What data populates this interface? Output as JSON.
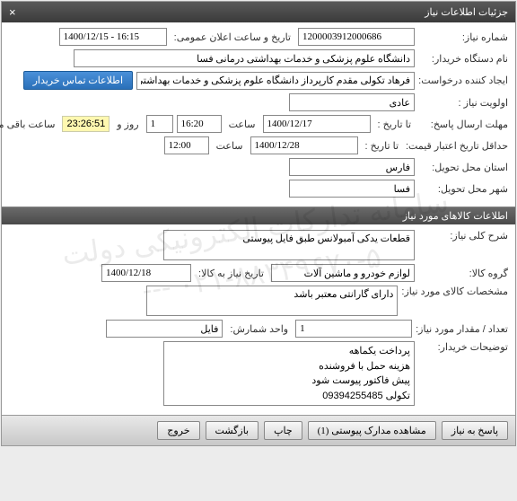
{
  "window": {
    "title": "جزئیات اطلاعات نیاز",
    "close": "×"
  },
  "form": {
    "need_number_label": "شماره نیاز:",
    "need_number": "1200003912000686",
    "public_datetime_label": "تاریخ و ساعت اعلان عمومی:",
    "public_datetime": "1400/12/15 - 16:15",
    "buyer_org_label": "نام دستگاه خریدار:",
    "buyer_org": "دانشگاه علوم پزشکی و خدمات بهداشتی درمانی فسا",
    "creator_label": "ایجاد کننده درخواست:",
    "creator": "فرهاد تکولی مقدم کارپرداز دانشگاه علوم پزشکی و خدمات بهداشتی درمانی فسا",
    "contact_btn": "اطلاعات تماس خریدار",
    "priority_label": "اولویت نیاز :",
    "priority": "عادی",
    "deadline_label": "مهلت ارسال پاسخ:",
    "to_date_label": "تا تاریخ :",
    "deadline_date": "1400/12/17",
    "time_label": "ساعت",
    "deadline_time": "16:20",
    "days": "1",
    "days_label": "روز و",
    "remaining_time": "23:26:51",
    "remaining_label": "ساعت باقی مانده",
    "price_validity_label": "حداقل تاریخ اعتبار قیمت:",
    "price_validity_date": "1400/12/28",
    "price_validity_time": "12:00",
    "province_label": "استان محل تحویل:",
    "province": "فارس",
    "city_label": "شهر محل تحویل:",
    "city": "فسا"
  },
  "section2_title": "اطلاعات کالاهای مورد نیاز",
  "goods": {
    "desc_label": "شرح کلی نیاز:",
    "desc": "قطعات یدکی آمبولانس طبق فایل پیوستی",
    "group_label": "گروه کالا:",
    "group": "لوازم خودرو و ماشین آلات",
    "need_date_label": "تاریخ نیاز به کالا:",
    "need_date": "1400/12/18",
    "spec_label": "مشخصات کالای مورد نیاز:",
    "spec": "دارای گارانتی معتبر باشد",
    "qty_label": "تعداد / مقدار مورد نیاز:",
    "qty": "1",
    "unit_label": "واحد شمارش:",
    "unit": "فایل",
    "buyer_notes_label": "توضیحات خریدار:",
    "buyer_notes_l1": "پرداخت یکماهه",
    "buyer_notes_l2": "هزینه حمل با فروشنده",
    "buyer_notes_l3": "پیش فاکتور پیوست شود",
    "buyer_notes_l4": "تکولی 09394255485"
  },
  "footer": {
    "respond": "پاسخ به نیاز",
    "attachments": "مشاهده مدارک پیوستی (1)",
    "print": "چاپ",
    "back": "بازگشت",
    "exit": "خروج"
  },
  "watermark_l1": "سامانه تدارکات الکترونیکی دولت",
  "watermark_l2": "۰۲۱-۸۸۳۴۹۶۷۰-۵ ---"
}
